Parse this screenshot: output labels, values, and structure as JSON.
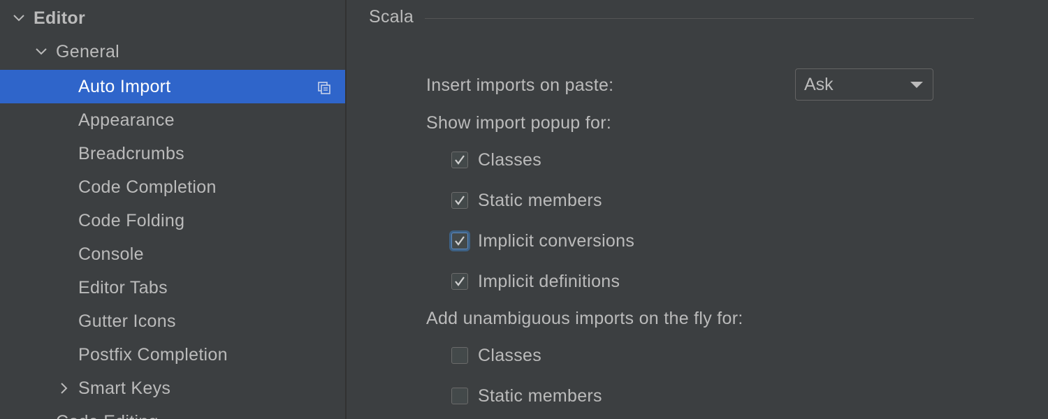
{
  "sidebar": {
    "items": [
      {
        "label": "Editor",
        "level": 0,
        "arrow": "expanded",
        "bold": true
      },
      {
        "label": "General",
        "level": 1,
        "arrow": "expanded"
      },
      {
        "label": "Auto Import",
        "level": 2,
        "selected": true
      },
      {
        "label": "Appearance",
        "level": 2
      },
      {
        "label": "Breadcrumbs",
        "level": 2
      },
      {
        "label": "Code Completion",
        "level": 2
      },
      {
        "label": "Code Folding",
        "level": 2
      },
      {
        "label": "Console",
        "level": 2
      },
      {
        "label": "Editor Tabs",
        "level": 2
      },
      {
        "label": "Gutter Icons",
        "level": 2
      },
      {
        "label": "Postfix Completion",
        "level": 2
      },
      {
        "label": "Smart Keys",
        "level": 2,
        "arrow": "collapsed"
      },
      {
        "label": "Code Editing",
        "level": 1
      }
    ],
    "selected_icon": "copy-icon"
  },
  "main": {
    "section_title": "Scala",
    "insert_imports_label": "Insert imports on paste:",
    "insert_imports_value": "Ask",
    "show_popup_label": "Show import popup for:",
    "show_popup_options": [
      {
        "label": "Classes",
        "checked": true
      },
      {
        "label": "Static members",
        "checked": true
      },
      {
        "label": "Implicit conversions",
        "checked": true,
        "focused": true
      },
      {
        "label": "Implicit definitions",
        "checked": true
      }
    ],
    "add_unambiguous_label": "Add unambiguous imports on the fly for:",
    "add_unambiguous_options": [
      {
        "label": "Classes",
        "checked": false
      },
      {
        "label": "Static members",
        "checked": false
      }
    ]
  },
  "colors": {
    "background": "#3c3f41",
    "selection": "#2f65ca",
    "text": "#bbbbbb",
    "focus_ring": "#3d6185"
  }
}
